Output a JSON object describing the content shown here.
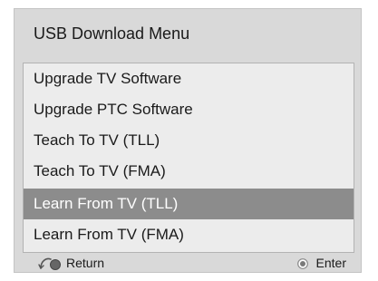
{
  "menu": {
    "title": "USB Download Menu",
    "items": [
      {
        "label": "Upgrade TV Software"
      },
      {
        "label": "Upgrade PTC Software"
      },
      {
        "label": "Teach To TV (TLL)"
      },
      {
        "label": "Teach To TV (FMA)"
      },
      {
        "label": "Learn From TV (TLL)"
      },
      {
        "label": "Learn From TV (FMA)"
      }
    ],
    "selected_index": 4
  },
  "footer": {
    "return_label": "Return",
    "enter_label": "Enter",
    "return_icon": "return-icon",
    "enter_icon": "enter-icon"
  },
  "colors": {
    "panel_background": "#d9d9d9",
    "list_background": "#ececec",
    "selected_background": "#8c8c8c",
    "selected_text": "#ffffff",
    "text": "#1a1a1a"
  }
}
